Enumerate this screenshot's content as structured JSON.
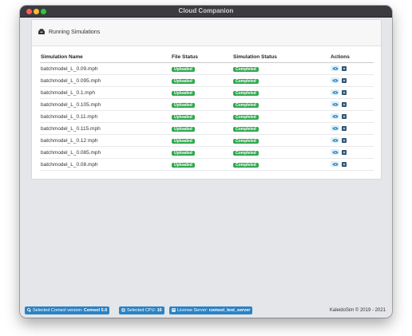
{
  "window": {
    "title": "Cloud Companion"
  },
  "panel": {
    "title": "Running Simulations"
  },
  "table": {
    "columns": [
      "Simulation Name",
      "File Status",
      "Simulation Status",
      "Actions"
    ],
    "rows": [
      {
        "name": "batchmodel_L_0.09.mph",
        "file_status": "Uploaded",
        "sim_status": "Completed"
      },
      {
        "name": "batchmodel_L_0.095.mph",
        "file_status": "Uploaded",
        "sim_status": "Completed"
      },
      {
        "name": "batchmodel_L_0.1.mph",
        "file_status": "Uploaded",
        "sim_status": "Completed"
      },
      {
        "name": "batchmodel_L_0.105.mph",
        "file_status": "Uploaded",
        "sim_status": "Completed"
      },
      {
        "name": "batchmodel_L_0.11.mph",
        "file_status": "Uploaded",
        "sim_status": "Completed"
      },
      {
        "name": "batchmodel_L_0.115.mph",
        "file_status": "Uploaded",
        "sim_status": "Completed"
      },
      {
        "name": "batchmodel_L_0.12 mph",
        "file_status": "Uploaded",
        "sim_status": "Completed"
      },
      {
        "name": "batchmodel_L_0.085.mph",
        "file_status": "Uploaded",
        "sim_status": "Completed"
      },
      {
        "name": "batchmodel_L_0.08.mph",
        "file_status": "Uploaded",
        "sim_status": "Completed"
      }
    ],
    "action_icons": [
      "eye-icon",
      "stop-icon"
    ]
  },
  "statusbar": {
    "comsol_label": "Selected Comsol version:",
    "comsol_value": "Comsol 5.6",
    "cpu_label": "Selected CPU:",
    "cpu_value": "16",
    "license_label": "License Server:",
    "license_value": "comsol_test_server",
    "copyright": "KaleidoSim © 2019 - 2021"
  },
  "colors": {
    "badge_green": "#2fa84f",
    "chip_blue": "#2b83c4",
    "titlebar": "#3c3b3f",
    "traffic_red": "#fe5f57",
    "traffic_yellow": "#febc2e",
    "traffic_green": "#28c840"
  }
}
